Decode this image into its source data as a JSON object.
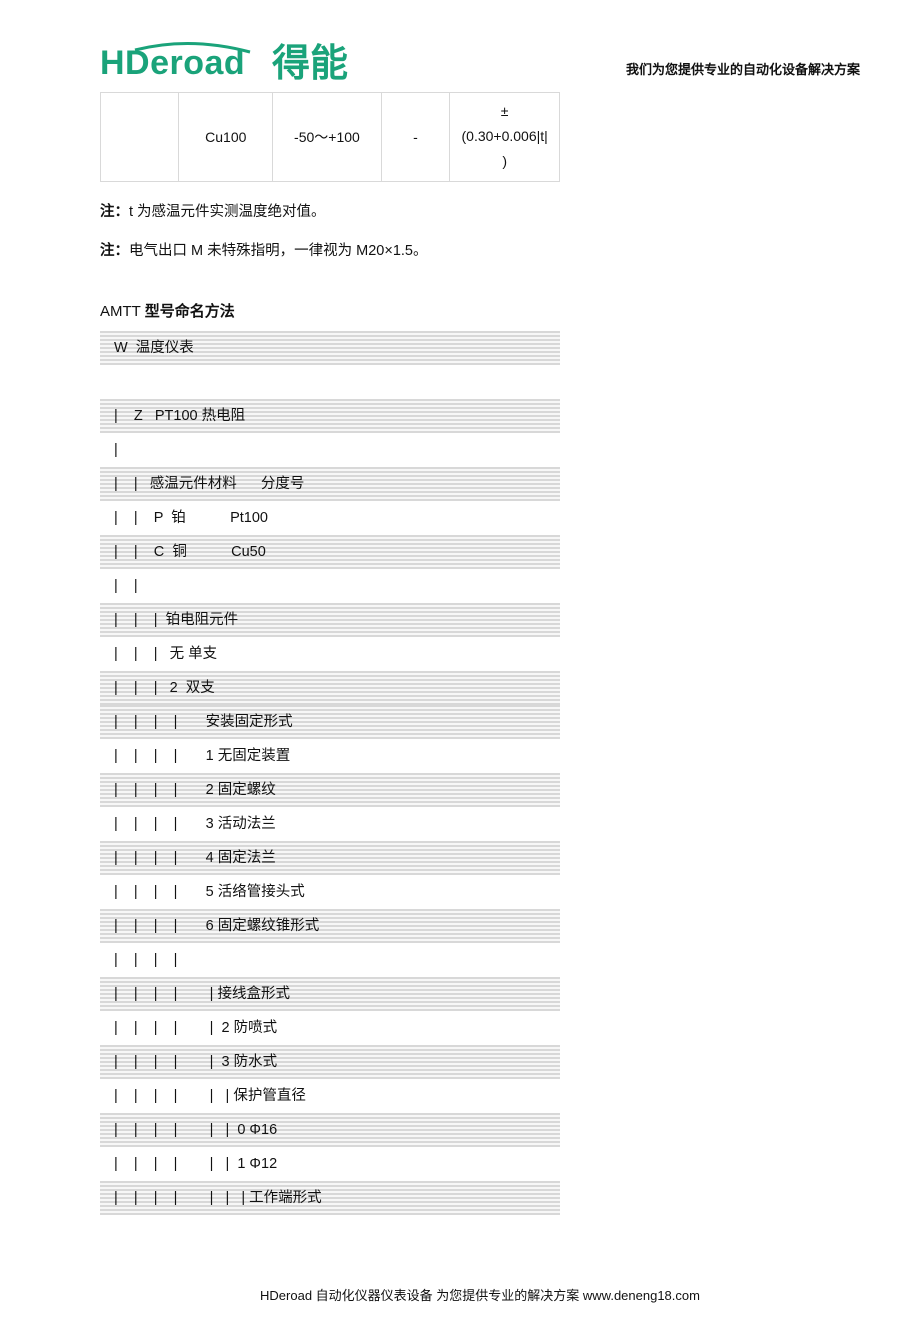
{
  "brand": {
    "logo_en": "HDeroad",
    "logo_cn": "得能"
  },
  "tagline": "我们为您提供专业的自动化设备解决方案",
  "spec_row": {
    "c0": "",
    "c1": "Cu100",
    "c2": "-50～+100",
    "c3": "-",
    "c4_lines": [
      "±",
      "(0.30+0.006|t|",
      ")"
    ]
  },
  "notes": [
    {
      "label": "注：",
      "text": "t 为感温元件实测温度绝对值。"
    },
    {
      "label": "注：",
      "text": "电气出口 M 未特殊指明，一律视为 M20×1.5。"
    }
  ],
  "section_title": {
    "prefix": "AMTT ",
    "cn": "型号命名方法"
  },
  "tree": [
    {
      "shade": true,
      "text": " W  温度仪表"
    },
    {
      "shade": false,
      "text": ""
    },
    {
      "shade": true,
      "text": " |    Z   PT100 热电阻"
    },
    {
      "shade": false,
      "text": " |"
    },
    {
      "shade": true,
      "text": " |    |   感温元件材料      分度号"
    },
    {
      "shade": false,
      "text": " |    |    P  铂           Pt100"
    },
    {
      "shade": true,
      "text": " |    |    C  铜           Cu50"
    },
    {
      "shade": false,
      "text": " |    |"
    },
    {
      "shade": true,
      "text": " |    |    |  铂电阻元件"
    },
    {
      "shade": false,
      "text": " |    |    |   无 单支"
    },
    {
      "shade": true,
      "text": " |    |    |   2  双支"
    },
    {
      "shade": true,
      "text": " |    |    |    |       安装固定形式"
    },
    {
      "shade": false,
      "text": " |    |    |    |       1 无固定装置"
    },
    {
      "shade": true,
      "text": " |    |    |    |       2 固定螺纹"
    },
    {
      "shade": false,
      "text": " |    |    |    |       3 活动法兰"
    },
    {
      "shade": true,
      "text": " |    |    |    |       4 固定法兰"
    },
    {
      "shade": false,
      "text": " |    |    |    |       5 活络管接头式"
    },
    {
      "shade": true,
      "text": " |    |    |    |       6 固定螺纹锥形式"
    },
    {
      "shade": false,
      "text": " |    |    |    |"
    },
    {
      "shade": true,
      "text": " |    |    |    |        | 接线盒形式"
    },
    {
      "shade": false,
      "text": " |    |    |    |        |  2 防喷式"
    },
    {
      "shade": true,
      "text": " |    |    |    |        |  3 防水式"
    },
    {
      "shade": false,
      "text": " |    |    |    |        |   | 保护管直径"
    },
    {
      "shade": true,
      "text": " |    |    |    |        |   |  0 Φ16"
    },
    {
      "shade": false,
      "text": " |    |    |    |        |   |  1 Φ12"
    },
    {
      "shade": true,
      "text": " |    |    |    |        |   |   | 工作端形式"
    }
  ],
  "footer": "HDeroad 自动化仪器仪表设备  为您提供专业的解决方案 www.deneng18.com"
}
